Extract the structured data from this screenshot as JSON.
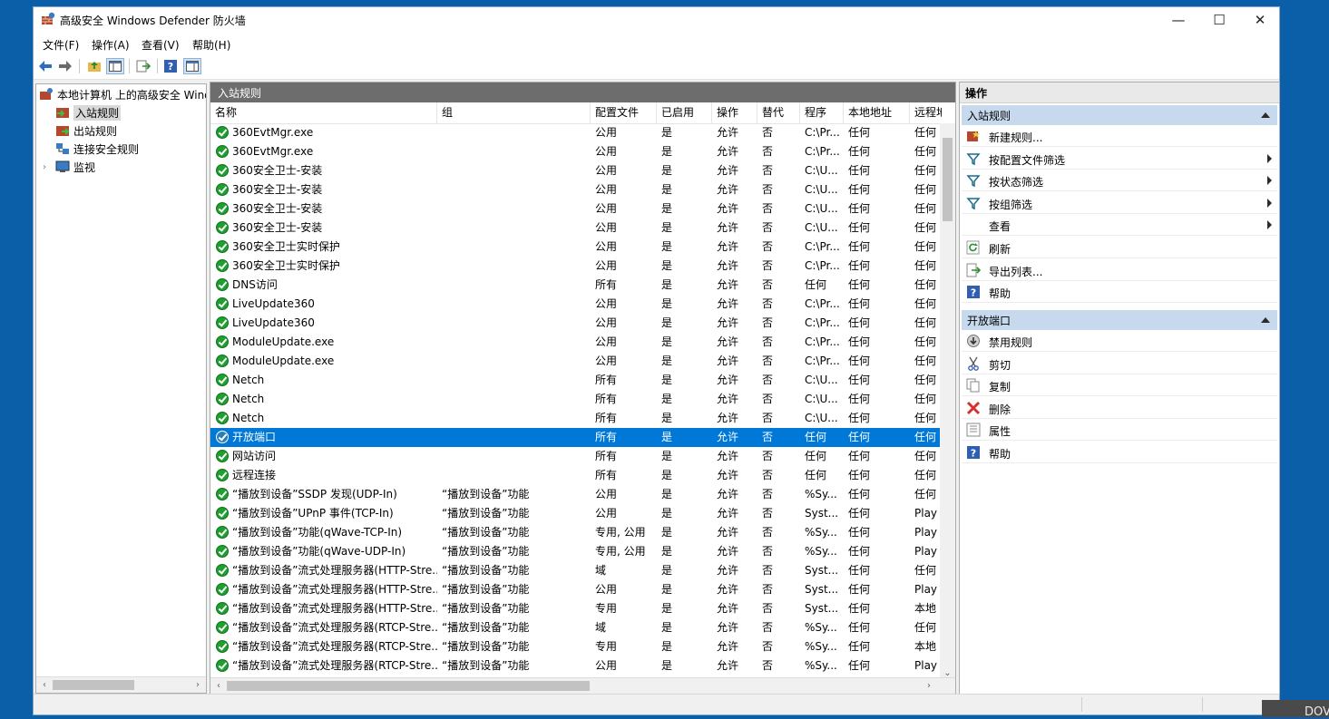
{
  "window": {
    "title": "高级安全 Windows Defender 防火墙"
  },
  "menu": [
    "文件(F)",
    "操作(A)",
    "查看(V)",
    "帮助(H)"
  ],
  "toolbar_icons": [
    "back-arrow-icon",
    "forward-arrow-icon",
    "up-folder-icon",
    "show-hide-tree-icon",
    "export-list-icon",
    "help-icon",
    "show-hide-action-pane-icon"
  ],
  "tree": {
    "root": "本地计算机 上的高级安全 Windows Defender 防火墙",
    "items": [
      "入站规则",
      "出站规则",
      "连接安全规则",
      "监视"
    ],
    "selected": "入站规则"
  },
  "center": {
    "title": "入站规则",
    "columns": [
      "名称",
      "组",
      "配置文件",
      "已启用",
      "操作",
      "替代",
      "程序",
      "本地地址",
      "远程地址"
    ],
    "rows": [
      [
        "360EvtMgr.exe",
        "",
        "公用",
        "是",
        "允许",
        "否",
        "C:\\Pr...",
        "任何",
        "任何"
      ],
      [
        "360EvtMgr.exe",
        "",
        "公用",
        "是",
        "允许",
        "否",
        "C:\\Pr...",
        "任何",
        "任何"
      ],
      [
        "360安全卫士-安装",
        "",
        "公用",
        "是",
        "允许",
        "否",
        "C:\\U...",
        "任何",
        "任何"
      ],
      [
        "360安全卫士-安装",
        "",
        "公用",
        "是",
        "允许",
        "否",
        "C:\\U...",
        "任何",
        "任何"
      ],
      [
        "360安全卫士-安装",
        "",
        "公用",
        "是",
        "允许",
        "否",
        "C:\\U...",
        "任何",
        "任何"
      ],
      [
        "360安全卫士-安装",
        "",
        "公用",
        "是",
        "允许",
        "否",
        "C:\\U...",
        "任何",
        "任何"
      ],
      [
        "360安全卫士实时保护",
        "",
        "公用",
        "是",
        "允许",
        "否",
        "C:\\Pr...",
        "任何",
        "任何"
      ],
      [
        "360安全卫士实时保护",
        "",
        "公用",
        "是",
        "允许",
        "否",
        "C:\\Pr...",
        "任何",
        "任何"
      ],
      [
        "DNS访问",
        "",
        "所有",
        "是",
        "允许",
        "否",
        "任何",
        "任何",
        "任何"
      ],
      [
        "LiveUpdate360",
        "",
        "公用",
        "是",
        "允许",
        "否",
        "C:\\Pr...",
        "任何",
        "任何"
      ],
      [
        "LiveUpdate360",
        "",
        "公用",
        "是",
        "允许",
        "否",
        "C:\\Pr...",
        "任何",
        "任何"
      ],
      [
        "ModuleUpdate.exe",
        "",
        "公用",
        "是",
        "允许",
        "否",
        "C:\\Pr...",
        "任何",
        "任何"
      ],
      [
        "ModuleUpdate.exe",
        "",
        "公用",
        "是",
        "允许",
        "否",
        "C:\\Pr...",
        "任何",
        "任何"
      ],
      [
        "Netch",
        "",
        "所有",
        "是",
        "允许",
        "否",
        "C:\\U...",
        "任何",
        "任何"
      ],
      [
        "Netch",
        "",
        "所有",
        "是",
        "允许",
        "否",
        "C:\\U...",
        "任何",
        "任何"
      ],
      [
        "Netch",
        "",
        "所有",
        "是",
        "允许",
        "否",
        "C:\\U...",
        "任何",
        "任何"
      ],
      [
        "开放端口",
        "",
        "所有",
        "是",
        "允许",
        "否",
        "任何",
        "任何",
        "任何"
      ],
      [
        "网站访问",
        "",
        "所有",
        "是",
        "允许",
        "否",
        "任何",
        "任何",
        "任何"
      ],
      [
        "远程连接",
        "",
        "所有",
        "是",
        "允许",
        "否",
        "任何",
        "任何",
        "任何"
      ],
      [
        "“播放到设备”SSDP 发现(UDP-In)",
        "“播放到设备”功能",
        "公用",
        "是",
        "允许",
        "否",
        "%Sy...",
        "任何",
        "任何"
      ],
      [
        "“播放到设备”UPnP 事件(TCP-In)",
        "“播放到设备”功能",
        "公用",
        "是",
        "允许",
        "否",
        "Syst...",
        "任何",
        "Play"
      ],
      [
        "“播放到设备”功能(qWave-TCP-In)",
        "“播放到设备”功能",
        "专用, 公用",
        "是",
        "允许",
        "否",
        "%Sy...",
        "任何",
        "Play"
      ],
      [
        "“播放到设备”功能(qWave-UDP-In)",
        "“播放到设备”功能",
        "专用, 公用",
        "是",
        "允许",
        "否",
        "%Sy...",
        "任何",
        "Play"
      ],
      [
        "“播放到设备”流式处理服务器(HTTP-Stre...",
        "“播放到设备”功能",
        "域",
        "是",
        "允许",
        "否",
        "Syst...",
        "任何",
        "任何"
      ],
      [
        "“播放到设备”流式处理服务器(HTTP-Stre...",
        "“播放到设备”功能",
        "公用",
        "是",
        "允许",
        "否",
        "Syst...",
        "任何",
        "Play"
      ],
      [
        "“播放到设备”流式处理服务器(HTTP-Stre...",
        "“播放到设备”功能",
        "专用",
        "是",
        "允许",
        "否",
        "Syst...",
        "任何",
        "本地"
      ],
      [
        "“播放到设备”流式处理服务器(RTCP-Stre...",
        "“播放到设备”功能",
        "域",
        "是",
        "允许",
        "否",
        "%Sy...",
        "任何",
        "任何"
      ],
      [
        "“播放到设备”流式处理服务器(RTCP-Stre...",
        "“播放到设备”功能",
        "专用",
        "是",
        "允许",
        "否",
        "%Sy...",
        "任何",
        "本地"
      ],
      [
        "“播放到设备”流式处理服务器(RTCP-Stre...",
        "“播放到设备”功能",
        "公用",
        "是",
        "允许",
        "否",
        "%Sy...",
        "任何",
        "Play"
      ]
    ],
    "selected_row": 16
  },
  "actions": {
    "title": "操作",
    "section1": {
      "title": "入站规则",
      "items": [
        {
          "label": "新建规则...",
          "icon": "new-rule-icon",
          "submenu": false
        },
        {
          "label": "按配置文件筛选",
          "icon": "filter-icon",
          "submenu": true
        },
        {
          "label": "按状态筛选",
          "icon": "filter-icon",
          "submenu": true
        },
        {
          "label": "按组筛选",
          "icon": "filter-icon",
          "submenu": true
        },
        {
          "label": "查看",
          "icon": "",
          "submenu": true
        },
        {
          "label": "刷新",
          "icon": "refresh-icon",
          "submenu": false
        },
        {
          "label": "导出列表...",
          "icon": "export-icon",
          "submenu": false
        },
        {
          "label": "帮助",
          "icon": "help-icon",
          "submenu": false
        }
      ]
    },
    "section2": {
      "title": "开放端口",
      "items": [
        {
          "label": "禁用规则",
          "icon": "disable-rule-icon"
        },
        {
          "label": "剪切",
          "icon": "cut-icon"
        },
        {
          "label": "复制",
          "icon": "copy-icon"
        },
        {
          "label": "删除",
          "icon": "delete-icon"
        },
        {
          "label": "属性",
          "icon": "properties-icon"
        },
        {
          "label": "帮助",
          "icon": "help-icon"
        }
      ]
    }
  },
  "overlay_text": "DOV",
  "colors": {
    "selection": "#0078d7",
    "section_header": "#c7d9ec",
    "pane_header": "#6d6d6d",
    "desktop": "#0b5ea8"
  }
}
